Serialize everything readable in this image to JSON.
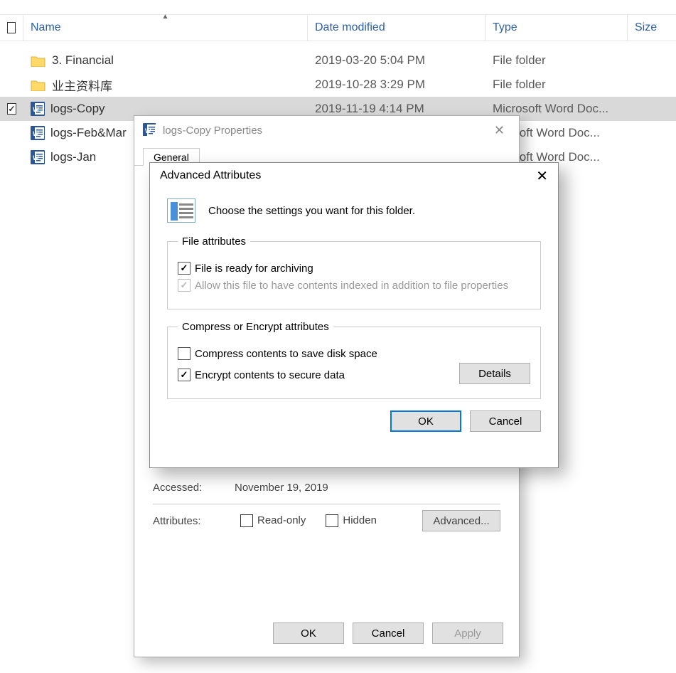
{
  "columns": {
    "name": "Name",
    "date": "Date modified",
    "type": "Type",
    "size": "Size"
  },
  "files": [
    {
      "name": "3. Financial",
      "date": "2019-03-20 5:04 PM",
      "type": "File folder",
      "icon": "folder",
      "checked": false
    },
    {
      "name": "业主资料库",
      "date": "2019-10-28 3:29 PM",
      "type": "File folder",
      "icon": "folder",
      "checked": false
    },
    {
      "name": "logs-Copy",
      "date": "2019-11-19 4:14 PM",
      "type": "Microsoft Word Doc...",
      "icon": "word",
      "checked": true,
      "selected": true
    },
    {
      "name": "logs-Feb&Mar",
      "date": "",
      "type": "...rosoft Word Doc...",
      "icon": "word",
      "checked": false
    },
    {
      "name": "logs-Jan",
      "date": "",
      "type": "...rosoft Word Doc...",
      "icon": "word",
      "checked": false
    }
  ],
  "props_dialog": {
    "title": "logs-Copy Properties",
    "tab_general": "General",
    "accessed_label": "Accessed:",
    "accessed_value": "November 19, 2019",
    "attributes_label": "Attributes:",
    "readonly": "Read-only",
    "hidden": "Hidden",
    "advanced_btn": "Advanced...",
    "ok": "OK",
    "cancel": "Cancel",
    "apply": "Apply"
  },
  "adv_dialog": {
    "title": "Advanced Attributes",
    "lead": "Choose the settings you want for this folder.",
    "group1": "File attributes",
    "archive": "File is ready for archiving",
    "index": "Allow this file to have contents indexed in addition to file properties",
    "group2": "Compress or Encrypt attributes",
    "compress": "Compress contents to save disk space",
    "encrypt": "Encrypt contents to secure data",
    "details": "Details",
    "ok": "OK",
    "cancel": "Cancel"
  }
}
